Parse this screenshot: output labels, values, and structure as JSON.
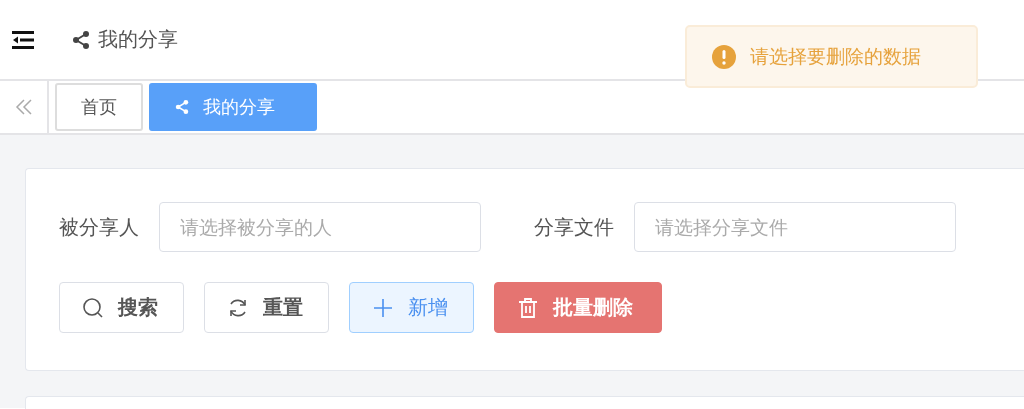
{
  "header": {
    "breadcrumb": "我的分享"
  },
  "tabs": [
    {
      "label": "首页",
      "selected": false,
      "icon": false
    },
    {
      "label": "我的分享",
      "selected": true,
      "icon": true
    }
  ],
  "filters": [
    {
      "label": "被分享人",
      "placeholder": "请选择被分享的人"
    },
    {
      "label": "分享文件",
      "placeholder": "请选择分享文件"
    }
  ],
  "buttons": [
    {
      "label": "搜索",
      "kind": "search"
    },
    {
      "label": "重置",
      "kind": "reset"
    },
    {
      "label": "新增",
      "kind": "add"
    },
    {
      "label": "批量删除",
      "kind": "delete"
    }
  ],
  "toast": {
    "kind": "warning",
    "message": "请选择要删除的数据"
  }
}
